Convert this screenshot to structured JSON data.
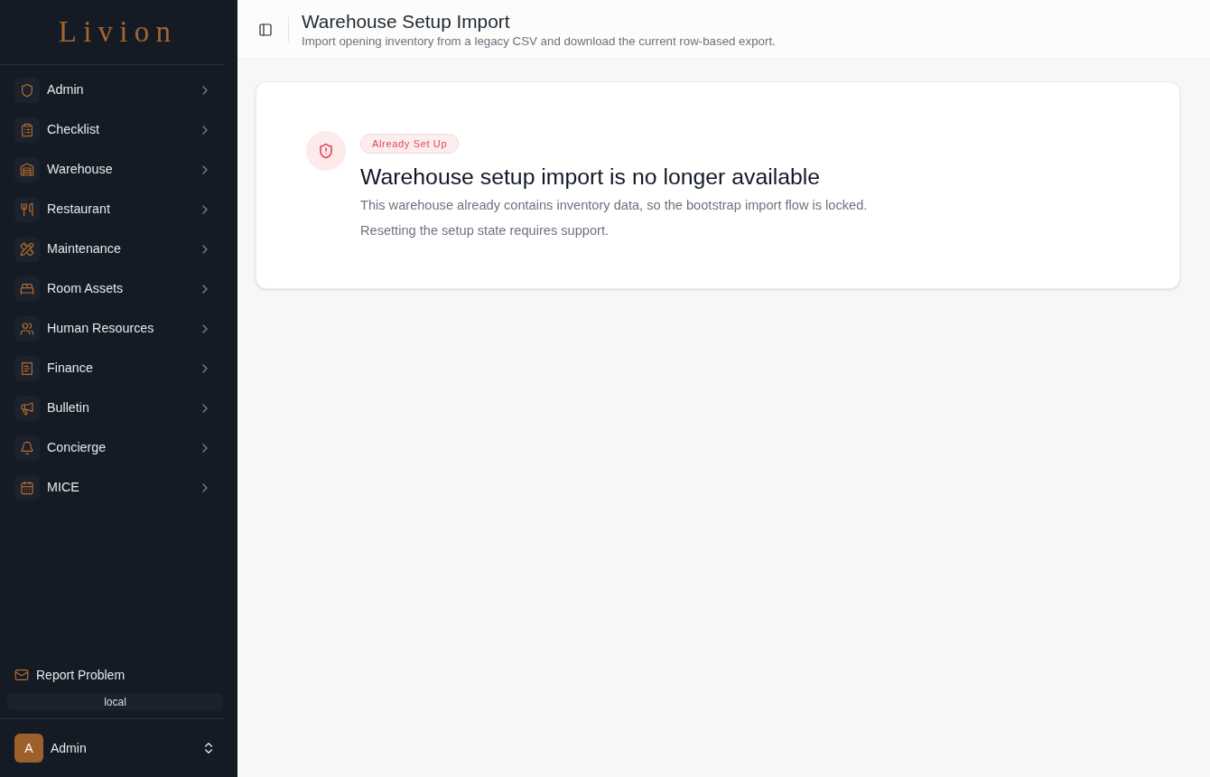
{
  "sidebar": {
    "logo": "Livion",
    "items": [
      {
        "label": "Admin",
        "expanded": false
      },
      {
        "label": "Checklist",
        "expanded": false
      },
      {
        "label": "Warehouse",
        "expanded": false
      },
      {
        "label": "Restaurant",
        "expanded": false
      },
      {
        "label": "Maintenance",
        "expanded": false
      },
      {
        "label": "Room Assets",
        "expanded": false
      },
      {
        "label": "Human Resources",
        "expanded": false
      },
      {
        "label": "Finance",
        "expanded": false
      },
      {
        "label": "Bulletin",
        "expanded": false
      },
      {
        "label": "Concierge",
        "expanded": false
      },
      {
        "label": "MICE",
        "expanded": false
      }
    ],
    "report_link": "Report Problem",
    "environment": "local",
    "user": {
      "initial": "A",
      "name": "Admin"
    }
  },
  "header": {
    "title": "Warehouse Setup Import",
    "subtitle": "Import opening inventory from a legacy CSV and download the current row-based export."
  },
  "notice": {
    "badge": "Already Set Up",
    "heading": "Warehouse setup import is no longer available",
    "paragraphs": [
      "This warehouse already contains inventory data, so the bootstrap import flow is locked.",
      "Resetting the setup state requires support."
    ]
  }
}
